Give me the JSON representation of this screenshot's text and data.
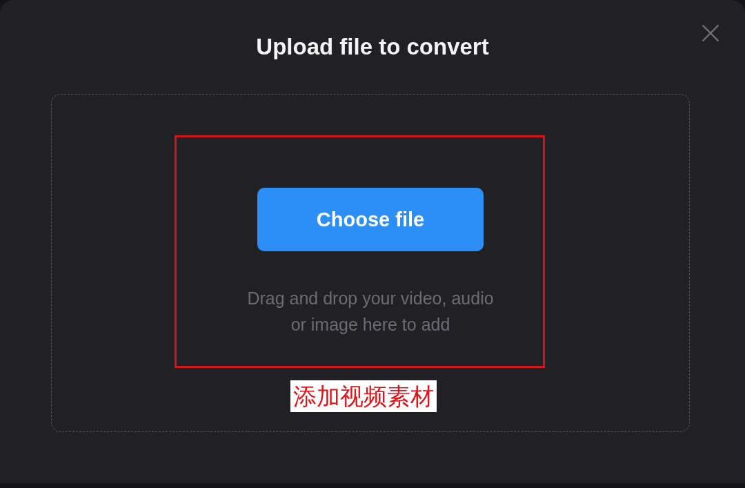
{
  "dialog": {
    "title": "Upload file to convert"
  },
  "drop_zone": {
    "button": "Choose file",
    "hint": "Drag and drop your video, audio or image here to add"
  },
  "annotation": {
    "label": "添加视频素材"
  }
}
